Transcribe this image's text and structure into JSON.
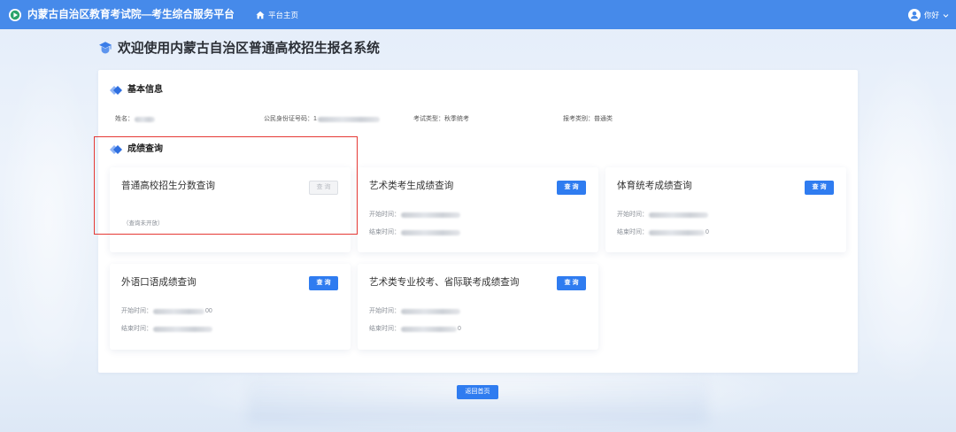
{
  "header": {
    "logo_icon": "exam-institute-logo-icon",
    "title": "内蒙古自治区教育考试院—考生综合服务平台",
    "home_icon": "home-icon",
    "home_label": "平台主页",
    "avatar_icon": "user-avatar-icon",
    "greeting": "你好",
    "dropdown_icon": "chevron-down-icon"
  },
  "page_title": {
    "icon": "graduation-cap-icon",
    "text": "欢迎使用内蒙古自治区普通高校招生报名系统"
  },
  "basic_info": {
    "heading": "基本信息",
    "fields": [
      {
        "label": "姓名："
      },
      {
        "label": "公民身份证号码：",
        "value": "1"
      },
      {
        "label": "考试类型：",
        "value": "秋季统考"
      },
      {
        "label": "报考类别：",
        "value": "普通类"
      }
    ]
  },
  "score_query": {
    "heading": "成绩查询",
    "cards": [
      {
        "title": "普通高校招生分数查询",
        "button": "查询",
        "button_enabled": false,
        "notice": "（查询未开放）"
      },
      {
        "title": "艺术类考生成绩查询",
        "button": "查询",
        "button_enabled": true,
        "start_label": "开始时间：",
        "end_label": "结束时间："
      },
      {
        "title": "体育统考成绩查询",
        "button": "查询",
        "button_enabled": true,
        "start_label": "开始时间：",
        "end_label": "结束时间：",
        "end_suffix": "0"
      },
      {
        "title": "外语口语成绩查询",
        "button": "查询",
        "button_enabled": true,
        "start_label": "开始时间：",
        "start_suffix": "00",
        "end_label": "结束时间："
      },
      {
        "title": "艺术类专业校考、省际联考成绩查询",
        "button": "查询",
        "button_enabled": true,
        "start_label": "开始时间：",
        "end_label": "结束时间：",
        "end_suffix": "0"
      }
    ]
  },
  "footer": {
    "back_button": "返回首页"
  },
  "colors": {
    "header_bg": "#468aea",
    "primary_button": "#2f7cf0",
    "disabled_button": "#f3f4f6",
    "highlight_border": "#e53935",
    "section_icon": "#2f6fe0"
  }
}
